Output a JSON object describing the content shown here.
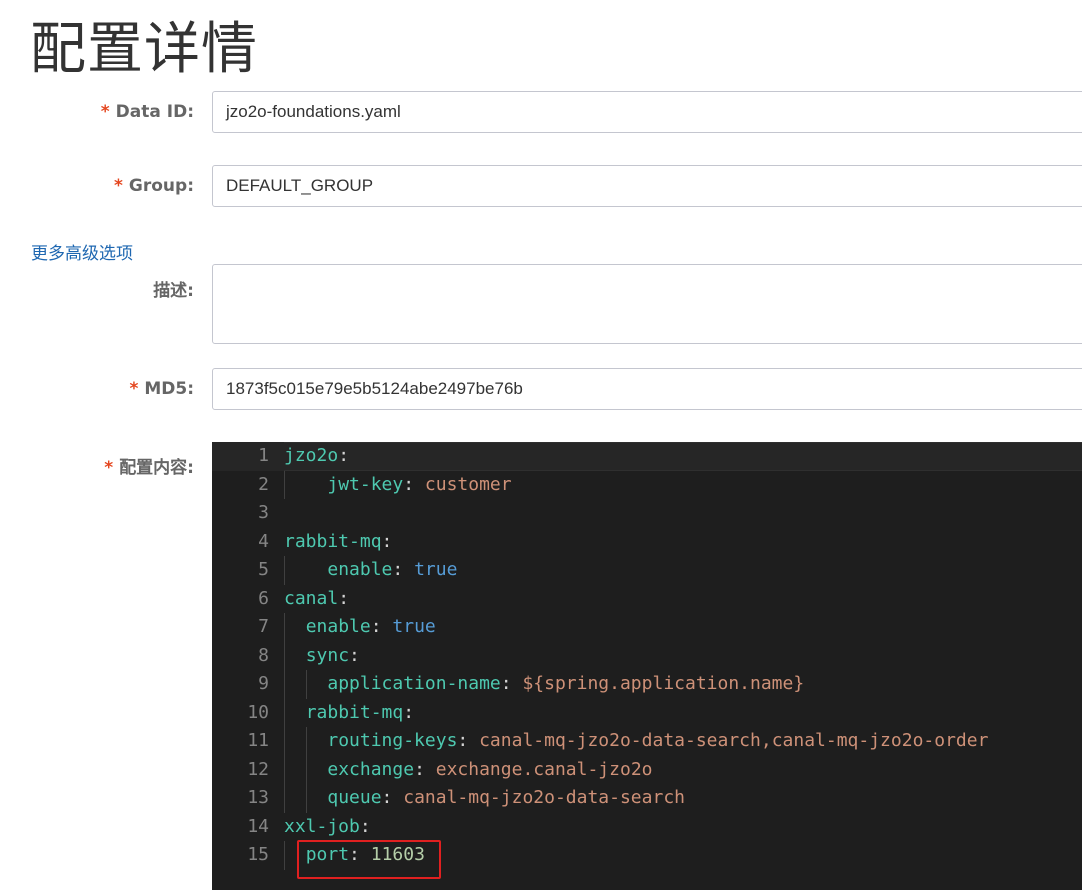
{
  "page": {
    "title": "配置详情"
  },
  "form": {
    "data_id": {
      "label": "Data ID:",
      "value": "jzo2o-foundations.yaml",
      "required": "*"
    },
    "group": {
      "label": "Group:",
      "value": "DEFAULT_GROUP",
      "required": "*"
    },
    "advanced_link": "更多高级选项",
    "description": {
      "label": "描述:",
      "value": ""
    },
    "md5": {
      "label": "MD5:",
      "value": "1873f5c015e79e5b5124abe2497be76b",
      "required": "*"
    },
    "content": {
      "label": "配置内容:",
      "required": "*"
    }
  },
  "editor": {
    "lines": [
      {
        "n": "1",
        "tokens": [
          [
            "k",
            "jzo2o"
          ],
          [
            "p",
            ":"
          ]
        ]
      },
      {
        "n": "2",
        "tokens": [
          [
            "p",
            "    "
          ],
          [
            "k",
            "jwt-key"
          ],
          [
            "p",
            ": "
          ],
          [
            "s",
            "customer"
          ]
        ]
      },
      {
        "n": "3",
        "tokens": []
      },
      {
        "n": "4",
        "tokens": [
          [
            "k",
            "rabbit-mq"
          ],
          [
            "p",
            ":"
          ]
        ]
      },
      {
        "n": "5",
        "tokens": [
          [
            "p",
            "    "
          ],
          [
            "k",
            "enable"
          ],
          [
            "p",
            ": "
          ],
          [
            "b",
            "true"
          ]
        ]
      },
      {
        "n": "6",
        "tokens": [
          [
            "k",
            "canal"
          ],
          [
            "p",
            ":"
          ]
        ]
      },
      {
        "n": "7",
        "tokens": [
          [
            "p",
            "  "
          ],
          [
            "k",
            "enable"
          ],
          [
            "p",
            ": "
          ],
          [
            "b",
            "true"
          ]
        ]
      },
      {
        "n": "8",
        "tokens": [
          [
            "p",
            "  "
          ],
          [
            "k",
            "sync"
          ],
          [
            "p",
            ":"
          ]
        ]
      },
      {
        "n": "9",
        "tokens": [
          [
            "p",
            "    "
          ],
          [
            "k",
            "application-name"
          ],
          [
            "p",
            ": "
          ],
          [
            "s",
            "${spring.application.name}"
          ]
        ]
      },
      {
        "n": "10",
        "tokens": [
          [
            "p",
            "  "
          ],
          [
            "k",
            "rabbit-mq"
          ],
          [
            "p",
            ":"
          ]
        ]
      },
      {
        "n": "11",
        "tokens": [
          [
            "p",
            "    "
          ],
          [
            "k",
            "routing-keys"
          ],
          [
            "p",
            ": "
          ],
          [
            "s",
            "canal-mq-jzo2o-data-search,canal-mq-jzo2o-order"
          ]
        ]
      },
      {
        "n": "12",
        "tokens": [
          [
            "p",
            "    "
          ],
          [
            "k",
            "exchange"
          ],
          [
            "p",
            ": "
          ],
          [
            "s",
            "exchange.canal-jzo2o"
          ]
        ]
      },
      {
        "n": "13",
        "tokens": [
          [
            "p",
            "    "
          ],
          [
            "k",
            "queue"
          ],
          [
            "p",
            ": "
          ],
          [
            "s",
            "canal-mq-jzo2o-data-search"
          ]
        ]
      },
      {
        "n": "14",
        "tokens": [
          [
            "k",
            "xxl-job"
          ],
          [
            "p",
            ":"
          ]
        ]
      },
      {
        "n": "15",
        "tokens": [
          [
            "p",
            "  "
          ],
          [
            "k",
            "port"
          ],
          [
            "p",
            ": "
          ],
          [
            "n",
            "11603"
          ]
        ]
      }
    ]
  }
}
